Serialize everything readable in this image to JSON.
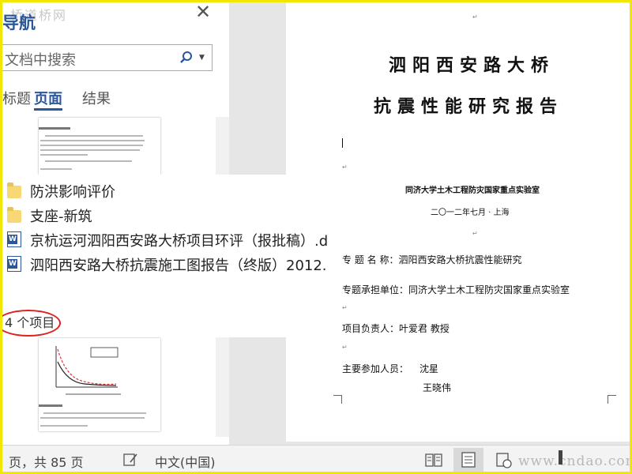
{
  "nav_pane": {
    "title": "导航",
    "watermark": "桥道桥网",
    "search_placeholder": "文档中搜索",
    "tabs": [
      {
        "label": "标题"
      },
      {
        "label": "页面"
      },
      {
        "label": "结果"
      }
    ]
  },
  "explorer": {
    "items": [
      {
        "type": "folder",
        "name": "防洪影响评价"
      },
      {
        "type": "folder",
        "name": "支座-新筑"
      },
      {
        "type": "word",
        "name": "京杭运河泗阳西安路大桥项目环评（报批稿）.d"
      },
      {
        "type": "word",
        "name": "泗阳西安路大桥抗震施工图报告（终版）2012."
      }
    ],
    "item_count": "4 个项目"
  },
  "document": {
    "title_line1": "泗阳西安路大桥",
    "title_line2": "抗震性能研究报告",
    "lab": "同济大学土木工程防灾国家重点实验室",
    "date": "二〇一二年七月 · 上海",
    "fields": {
      "topic": "专 题 名 称：泗阳西安路大桥抗震性能研究",
      "unit": "专题承担单位：同济大学土木工程防灾国家重点实验室",
      "leader": "项目负责人：叶爱君 教授",
      "members_label": "主要参加人员：",
      "member1": "沈星",
      "member2": "王晓伟"
    }
  },
  "status_bar": {
    "pages": "页，共 85 页",
    "language": "中文(中国)",
    "watermark": "www.cndao.com"
  },
  "colors": {
    "accent": "#2b579a",
    "highlight_frame": "#f0e800",
    "annotation_circle": "#e0201e"
  }
}
